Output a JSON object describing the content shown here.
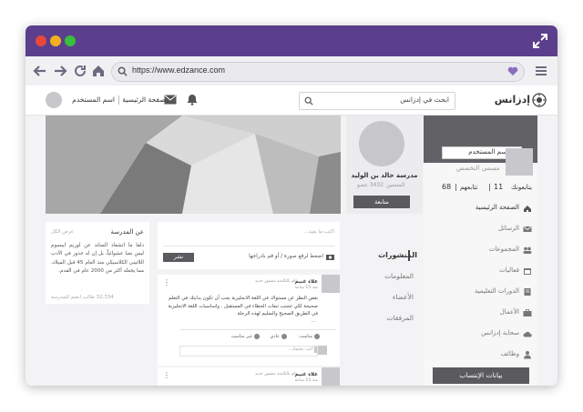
{
  "browser": {
    "url": "https://www.edzance.com"
  },
  "header": {
    "logo_text": "إدزانس",
    "search_placeholder": "ابحث في إدزانس",
    "home_link": "الصفحة الرئيسية",
    "username": "اسم المستخدم"
  },
  "profile": {
    "username": "اسم المستخدم",
    "job_title": "مسمى التخصص",
    "stats": {
      "following_label": "يتابعونك",
      "following_count": "11",
      "followers_label": "تتابعهم",
      "followers_count": "68"
    },
    "menu": [
      {
        "label": "الصفحة الرئيسية",
        "icon": "home-icon"
      },
      {
        "label": "الرسائل",
        "icon": "mail-icon"
      },
      {
        "label": "المجموعات",
        "icon": "groups-icon"
      },
      {
        "label": "فعاليات",
        "icon": "calendar-icon"
      },
      {
        "label": "الدورات التعليمية",
        "icon": "book-icon"
      },
      {
        "label": "الأعمال",
        "icon": "briefcase-icon"
      },
      {
        "label": "سحابة إدزانس",
        "icon": "cloud-icon"
      },
      {
        "label": "وظائف",
        "icon": "jobs-icon"
      }
    ],
    "affiliation_button": "بيانات الإنتساب"
  },
  "school": {
    "name": "مدرسة خالد بن الوليد",
    "members_label": "المنتمين",
    "members_count": "3432 عضو",
    "follow_button": "متابعة"
  },
  "tabs": [
    "المنشورات",
    "المعلومات",
    "الأعضاء",
    "المرفقات"
  ],
  "composer": {
    "placeholder": "اكتب ما يفيد...",
    "photo_label": "اضغط لرفع صورة / أو قم بادراجها",
    "publish_button": "نشر"
  },
  "posts": [
    {
      "author": "علاء غنيم",
      "role": "عام بالكامنة منشور جديد",
      "time": "منذ 15 ساعة",
      "text": "بغض النظر عن مستواك في اللغة الانجليزية يجب أن تكون بدايتك في التعلم صحيحة لكي تتجنب تبعات الخطاء في المستقبل . واساسيات اللغة الانجليزية في الطريق الصحيح والسليم لهذه الرحلة",
      "more": "...",
      "like_label": "مناسب",
      "comment_label": "عادي",
      "share_label": "غير مناسب",
      "comment_placeholder": "اكتب تعليقك..."
    },
    {
      "author": "علاء غنيم",
      "role": "عام بالكامنة منشور جديد",
      "time": "منذ 15 ساعة"
    }
  ],
  "about": {
    "title": "عن المدرسة",
    "edit_label": "عرض الكل",
    "text": "دلفا ما اتشفاد الساتد عن لوريم ايبسوم ليس نصا عشوائياً، بل إن له جذور في الأدب اللاتيني الكلاسيكي منذ العام 45 قبل الميلاد، مما يجعله أكثر من 2000 عام في القدم.",
    "footer": "32,334 طالب انضم للمدرسة"
  }
}
